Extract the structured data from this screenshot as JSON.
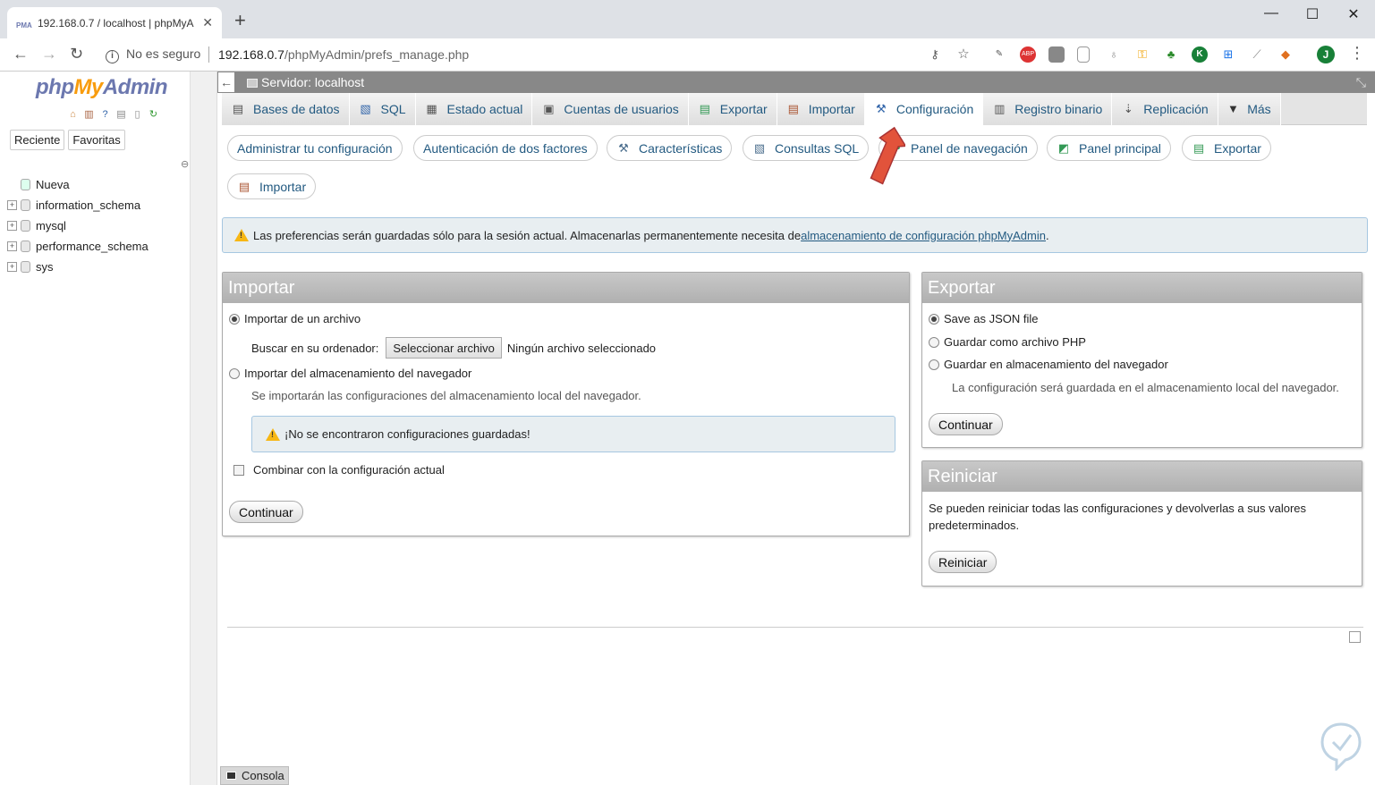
{
  "browser": {
    "tab_title": "192.168.0.7 / localhost | phpMyA",
    "tab_favicon": "PMA",
    "security_label": "No es seguro",
    "url_host": "192.168.0.7",
    "url_path": "/phpMyAdmin/prefs_manage.php",
    "profile_initial": "J"
  },
  "logo": {
    "php": "php",
    "my": "My",
    "admin": "Admin"
  },
  "left_tabs": {
    "recent": "Reciente",
    "favorites": "Favoritas"
  },
  "tree": [
    {
      "label": "Nueva"
    },
    {
      "label": "information_schema"
    },
    {
      "label": "mysql"
    },
    {
      "label": "performance_schema"
    },
    {
      "label": "sys"
    }
  ],
  "server_bar": {
    "label": "Servidor: localhost"
  },
  "top_menu": [
    {
      "label": "Bases de datos",
      "icon": "database-icon"
    },
    {
      "label": "SQL",
      "icon": "sql-icon"
    },
    {
      "label": "Estado actual",
      "icon": "status-icon"
    },
    {
      "label": "Cuentas de usuarios",
      "icon": "users-icon"
    },
    {
      "label": "Exportar",
      "icon": "export-icon"
    },
    {
      "label": "Importar",
      "icon": "import-icon"
    },
    {
      "label": "Configuración",
      "icon": "wrench-icon"
    },
    {
      "label": "Registro binario",
      "icon": "binlog-icon"
    },
    {
      "label": "Replicación",
      "icon": "replication-icon"
    },
    {
      "label": "Más",
      "icon": "more-caret-icon"
    }
  ],
  "sub_menu": [
    {
      "label": "Administrar tu configuración"
    },
    {
      "label": "Autenticación de dos factores"
    },
    {
      "label": "Características"
    },
    {
      "label": "Consultas SQL"
    },
    {
      "label": "Panel de navegación"
    },
    {
      "label": "Panel principal"
    },
    {
      "label": "Exportar"
    },
    {
      "label": "Importar"
    }
  ],
  "notice": {
    "text": "Las preferencias serán guardadas sólo para la sesión actual. Almacenarlas permanentemente necesita de ",
    "link": "almacenamiento de configuración phpMyAdmin",
    "suffix": "."
  },
  "import_panel": {
    "title": "Importar",
    "option_file": "Importar de un archivo",
    "browse_label": "Buscar en su ordenador:",
    "file_button": "Seleccionar archivo",
    "no_file": "Ningún archivo seleccionado",
    "option_browser": "Importar del almacenamiento del navegador",
    "browser_hint": "Se importarán las configuraciones del almacenamiento local del navegador.",
    "none_found": "¡No se encontraron configuraciones guardadas!",
    "merge_label": "Combinar con la configuración actual",
    "submit": "Continuar"
  },
  "export_panel": {
    "title": "Exportar",
    "option_json": "Save as JSON file",
    "option_php": "Guardar como archivo PHP",
    "option_browser": "Guardar en almacenamiento del navegador",
    "browser_hint": "La configuración será guardada en el almacenamiento local del navegador.",
    "submit": "Continuar"
  },
  "reset_panel": {
    "title": "Reiniciar",
    "text_line1": "Se pueden reiniciar todas las configuraciones y devolverlas a sus valores",
    "text_line2": "predeterminados.",
    "submit": "Reiniciar"
  },
  "console": {
    "label": "Consola"
  },
  "colors": {
    "accent_link": "#235a81",
    "server_bar": "#888888",
    "arrow": "#e2533b",
    "notice_bg": "#e8eef1"
  }
}
